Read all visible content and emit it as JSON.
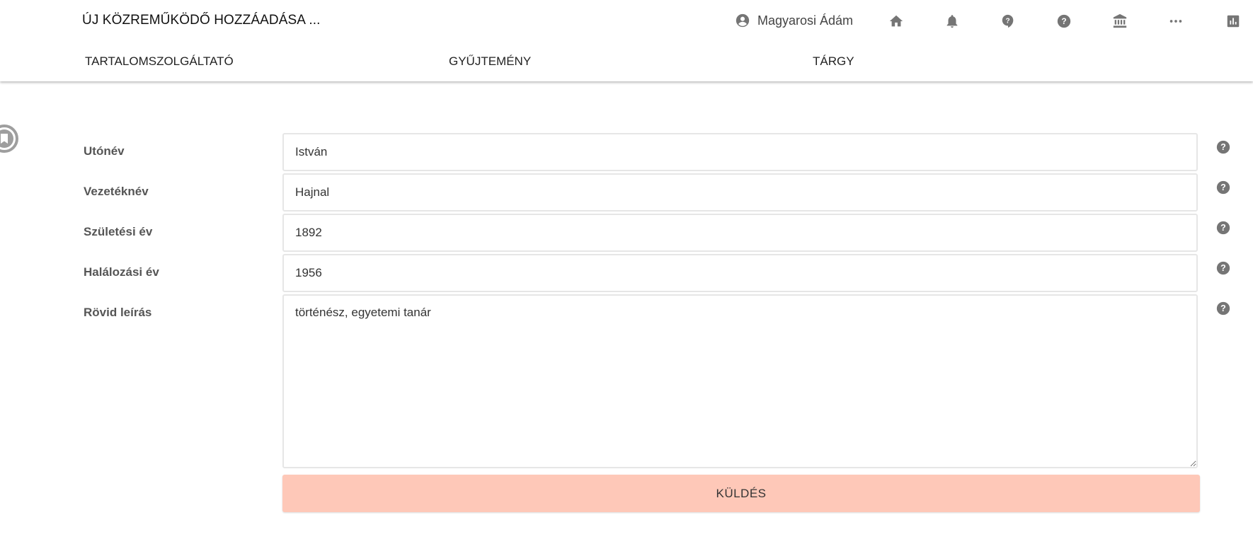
{
  "header": {
    "title": "ÚJ KÖZREMŰKÖDŐ HOZZÁADÁSA ...",
    "user_name": "Magyarosi Ádám",
    "icons": [
      "home-icon",
      "bell-icon",
      "help-bubble-icon",
      "help-circle-icon",
      "institution-icon",
      "more-icon",
      "stats-icon"
    ]
  },
  "tabs": [
    {
      "label": "TARTALOMSZOLGÁLTATÓ"
    },
    {
      "label": "GYŰJTEMÉNY"
    },
    {
      "label": "TÁRGY"
    }
  ],
  "form": {
    "first_name": {
      "label": "Utónév",
      "value": "István"
    },
    "last_name": {
      "label": "Vezetéknév",
      "value": "Hajnal"
    },
    "birth_year": {
      "label": "Születési év",
      "value": "1892"
    },
    "death_year": {
      "label": "Halálozási év",
      "value": "1956"
    },
    "description": {
      "label": "Rövid leírás",
      "value": "történész, egyetemi tanár"
    },
    "submit_label": "KÜLDÉS"
  },
  "colors": {
    "submit_bg": "#fec8b8",
    "icon_gray": "#757575"
  }
}
